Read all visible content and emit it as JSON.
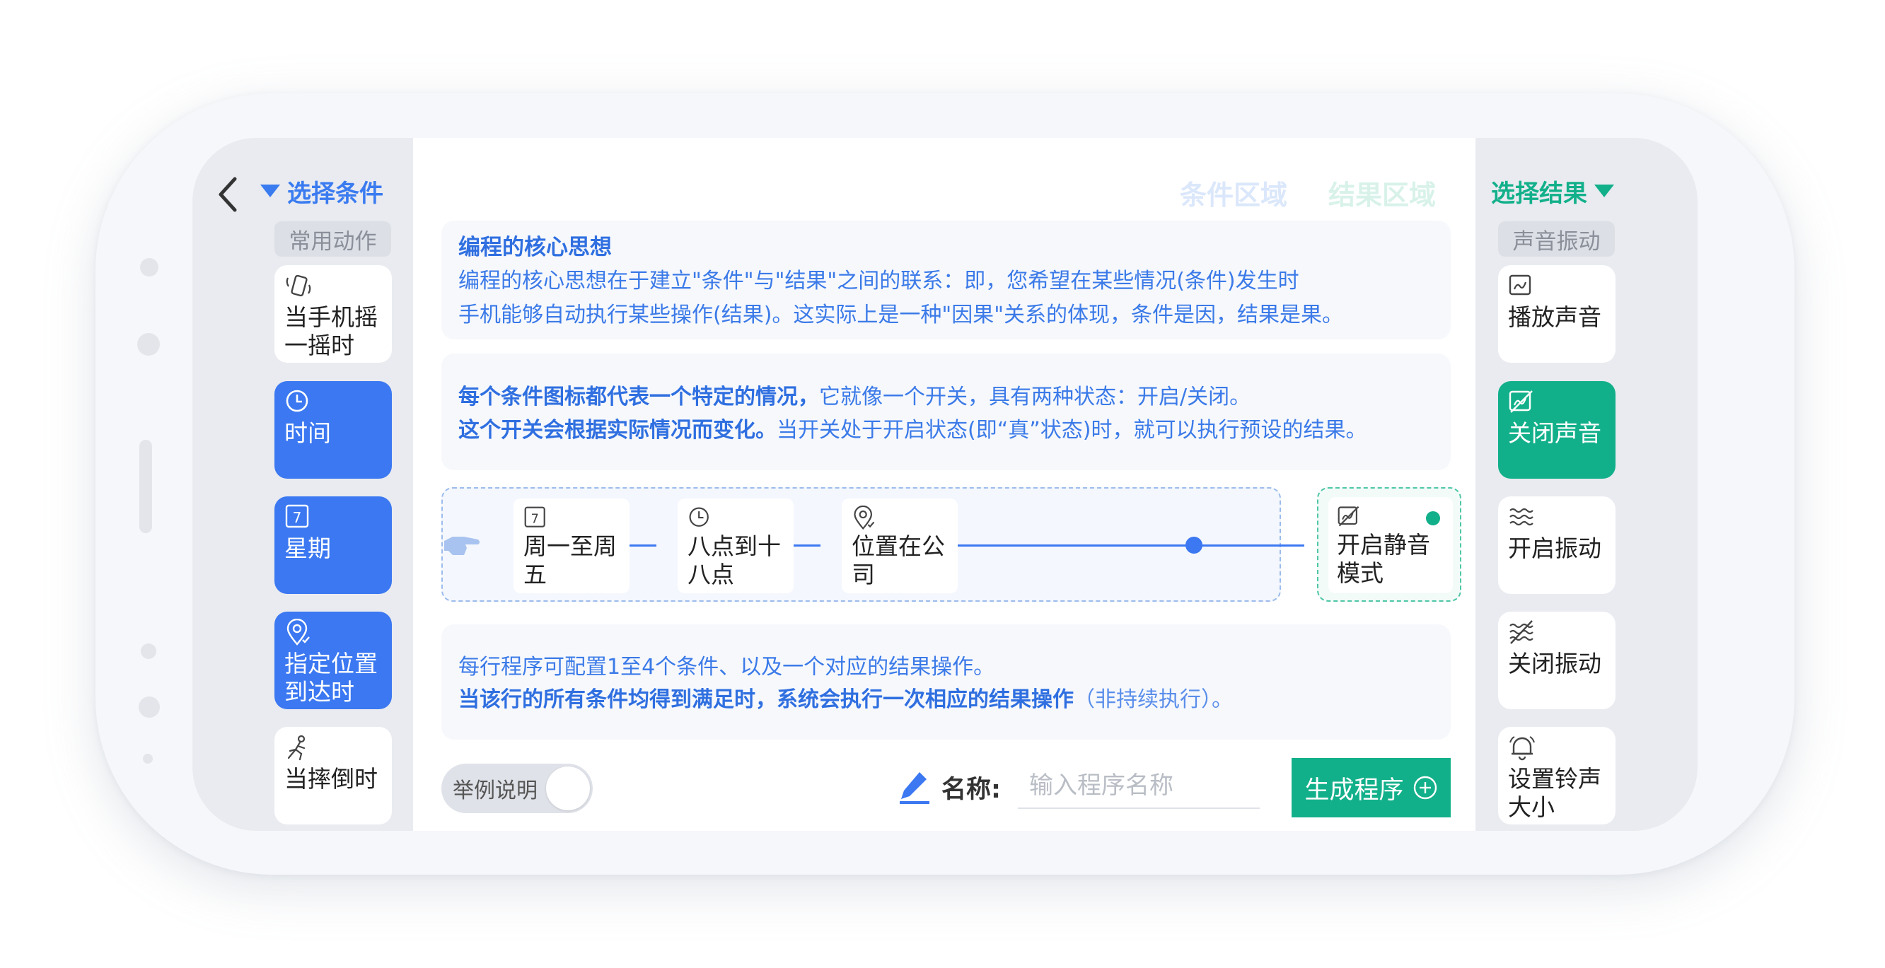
{
  "left": {
    "title": "选择条件",
    "category": "常用动作",
    "items": [
      {
        "label": "当手机摇一摇时",
        "icon": "phone-shake-icon"
      },
      {
        "label": "时间",
        "icon": "clock-icon"
      },
      {
        "label": "星期",
        "icon": "calendar-7-icon",
        "icon_text": "7"
      },
      {
        "label": "指定位置到达时",
        "icon": "location-pin-icon"
      },
      {
        "label": "当摔倒时",
        "icon": "falling-person-icon"
      }
    ]
  },
  "header": {
    "tab_conditions": "条件区域",
    "tab_results": "结果区域"
  },
  "intro": {
    "title": "编程的核心思想",
    "line1": "编程的核心思想在于建立\"条件\"与\"结果\"之间的联系：即，您希望在某些情况(条件)发生时",
    "line2": "手机能够自动执行某些操作(结果)。这实际上是一种\"因果\"关系的体现，条件是因，结果是果。"
  },
  "switch_info": {
    "l1_bold": "每个条件图标都代表一个特定的情况，",
    "l1_rest": "它就像一个开关，具有两种状态：开启/关闭。",
    "l2_bold": "这个开关会根据实际情况而变化。",
    "l2_rest": "当开关处于开启状态(即“真”状态)时，就可以执行预设的结果。"
  },
  "demo": {
    "conditions": [
      {
        "label": "周一至周五",
        "icon": "calendar-7-icon",
        "icon_text": "7"
      },
      {
        "label": "八点到十八点",
        "icon": "clock-icon"
      },
      {
        "label": "位置在公司",
        "icon": "location-pin-icon"
      }
    ],
    "result": {
      "label": "开启静音模式",
      "icon": "mute-sound-icon"
    }
  },
  "rules": {
    "line1": "每行程序可配置1至4个条件、以及一个对应的结果操作。",
    "line2_bold": "当该行的所有条件均得到满足时，系统会执行一次相应的结果操作",
    "line2_rest": "（非持续执行）。"
  },
  "bottom": {
    "toggle_label": "举例说明",
    "name_label": "名称:",
    "name_placeholder": "输入程序名称",
    "name_value": "",
    "generate_label": "生成程序"
  },
  "right": {
    "title": "选择结果",
    "category": "声音振动",
    "items": [
      {
        "label": "播放声音",
        "icon": "play-sound-icon"
      },
      {
        "label": "关闭声音",
        "icon": "mute-sound-icon"
      },
      {
        "label": "开启振动",
        "icon": "vibrate-on-icon"
      },
      {
        "label": "关闭振动",
        "icon": "vibrate-off-icon"
      },
      {
        "label": "设置铃声大小",
        "icon": "bell-icon"
      }
    ]
  },
  "colors": {
    "condition_accent": "#3b78f1",
    "result_accent": "#12b08a",
    "panel_bg": "#f6f8fc"
  }
}
